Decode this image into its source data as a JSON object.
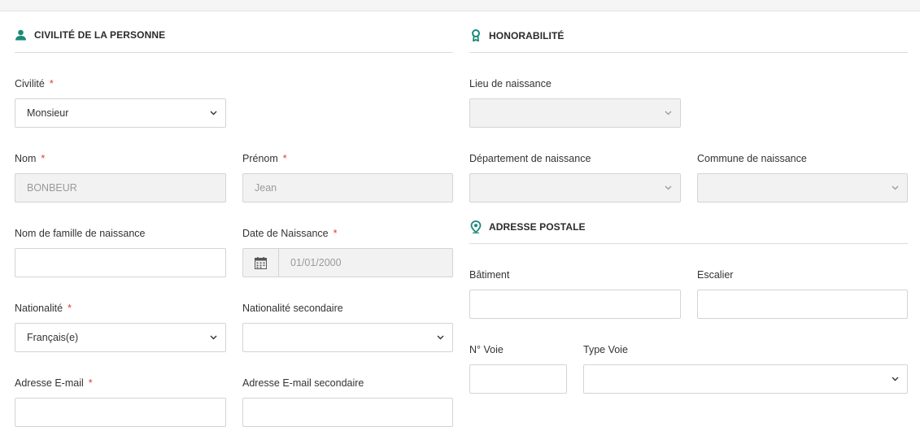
{
  "sections": {
    "civilite": {
      "title": "CIVILITÉ DE LA PERSONNE"
    },
    "honorabilite": {
      "title": "HONORABILITÉ"
    },
    "adresse": {
      "title": "ADRESSE POSTALE"
    }
  },
  "required_mark": "*",
  "form": {
    "civilite": {
      "label": "Civilité",
      "value": "Monsieur"
    },
    "nom": {
      "label": "Nom",
      "value": "BONBEUR"
    },
    "prenom": {
      "label": "Prénom",
      "value": "Jean"
    },
    "nom_naissance": {
      "label": "Nom de famille de naissance",
      "value": ""
    },
    "date_naissance": {
      "label": "Date de Naissance",
      "value": "01/01/2000"
    },
    "nationalite": {
      "label": "Nationalité",
      "value": "Français(e)"
    },
    "nationalite_secondaire": {
      "label": "Nationalité secondaire",
      "value": ""
    },
    "email": {
      "label": "Adresse E-mail"
    },
    "email_secondaire": {
      "label": "Adresse E-mail secondaire"
    },
    "lieu_naissance": {
      "label": "Lieu de naissance",
      "value": ""
    },
    "departement_naissance": {
      "label": "Département de naissance",
      "value": ""
    },
    "commune_naissance": {
      "label": "Commune de naissance",
      "value": ""
    },
    "batiment": {
      "label": "Bâtiment",
      "value": ""
    },
    "escalier": {
      "label": "Escalier",
      "value": ""
    },
    "num_voie": {
      "label": "N° Voie",
      "value": ""
    },
    "type_voie": {
      "label": "Type Voie",
      "value": ""
    }
  },
  "colors": {
    "accent": "#1a8a7a",
    "required": "#e53935",
    "disabled_bg": "#f2f2f2",
    "border": "#d4d4d4"
  },
  "icons": {
    "civilite": "person-icon",
    "honorabilite": "ribbon-badge-icon",
    "adresse": "map-pin-icon",
    "date": "calendar-icon",
    "select": "chevron-down-icon"
  }
}
